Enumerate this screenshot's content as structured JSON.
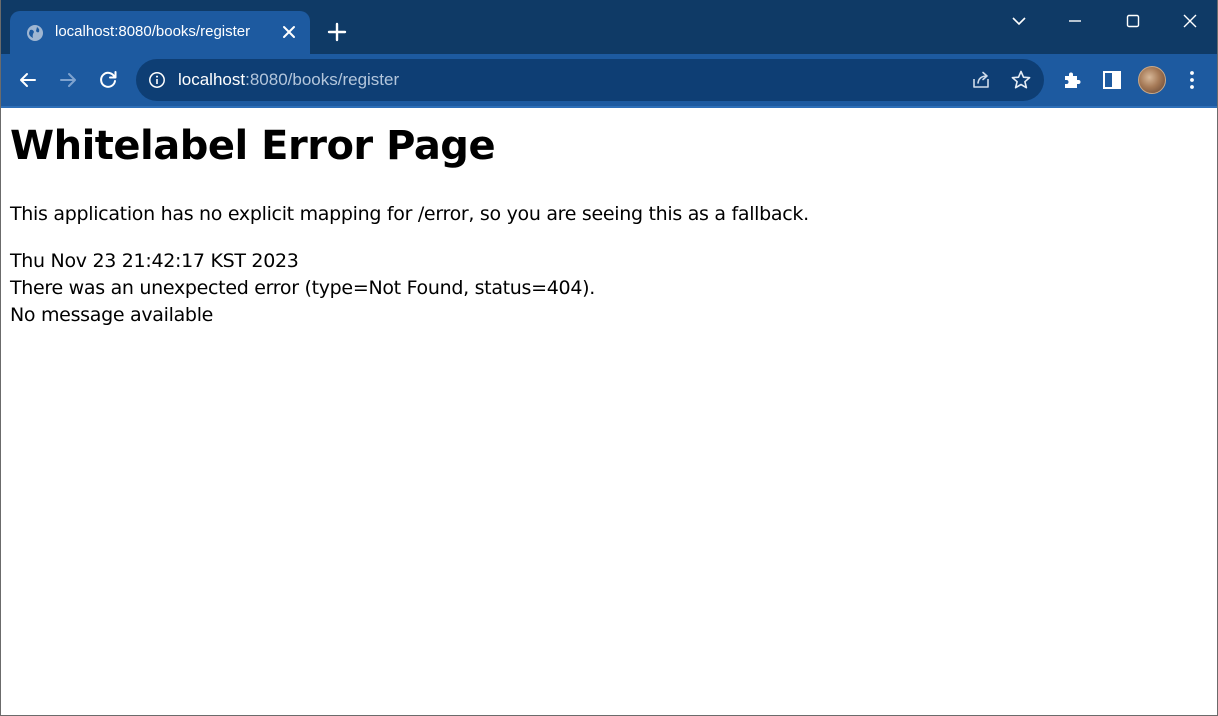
{
  "browser": {
    "tab": {
      "title": "localhost:8080/books/register"
    },
    "address_bar": {
      "host": "localhost",
      "rest": ":8080/books/register"
    },
    "icons": [
      "globe-icon",
      "close-icon",
      "plus-icon",
      "chevron-down-icon",
      "minimize-icon",
      "maximize-icon",
      "window-close-icon",
      "back-arrow-icon",
      "forward-arrow-icon",
      "reload-icon",
      "info-icon",
      "share-icon",
      "star-icon",
      "puzzle-icon",
      "side-panel-icon",
      "kebab-menu-icon"
    ],
    "colors": {
      "titlebar": "#0f3a66",
      "toolbar": "#1d5aa0",
      "omnibox": "#0e3e74"
    }
  },
  "page": {
    "heading": "Whitelabel Error Page",
    "description": "This application has no explicit mapping for /error, so you are seeing this as a fallback.",
    "timestamp": "Thu Nov 23 21:42:17 KST 2023",
    "error_line": "There was an unexpected error (type=Not Found, status=404).",
    "message": "No message available"
  }
}
